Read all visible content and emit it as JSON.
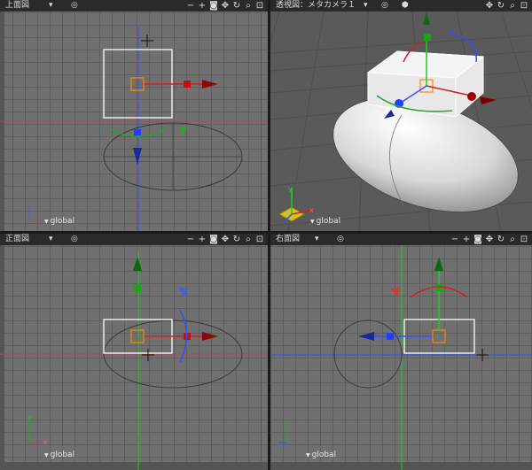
{
  "viewports": {
    "top": {
      "title": "上面図",
      "mode_icon": "▾",
      "view_icon": "◎",
      "coord_label": "global"
    },
    "perspective": {
      "title": "透視図：メタカメラ１",
      "mode_icon": "▾",
      "view_icon": "◎",
      "cube_icon": "⬢",
      "coord_label": "global"
    },
    "front": {
      "title": "正面図",
      "mode_icon": "▾",
      "view_icon": "◎",
      "coord_label": "global"
    },
    "right": {
      "title": "右面図",
      "mode_icon": "▾",
      "view_icon": "◎",
      "coord_label": "global"
    }
  },
  "toolbar_icons": [
    "minus-icon",
    "plus-icon",
    "camera-icon",
    "move-icon",
    "rotate-icon",
    "zoom-icon",
    "fit-icon"
  ],
  "toolbar_glyphs": {
    "minus": "−",
    "plus": "+",
    "camera": "◙",
    "move": "✥",
    "rotate": "↻",
    "zoom": "⌕",
    "fit": "⊡"
  },
  "axis_labels": {
    "x": "x",
    "y": "y"
  },
  "colors": {
    "viewport_bg": "#707070",
    "grid_line": "#5f5f5f",
    "axis_x": "#ff3030",
    "axis_y": "#22cc22",
    "axis_z": "#3050ff",
    "selection": "#ffffff",
    "manipulator_center": "#ff8800"
  }
}
